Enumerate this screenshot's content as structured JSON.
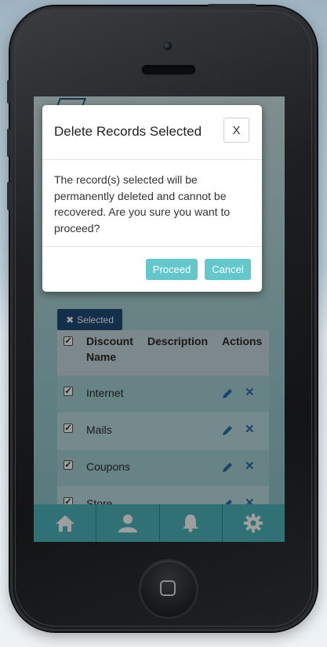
{
  "dialog": {
    "title": "Delete Records Selected",
    "close_label": "X",
    "message": "The record(s) selected will be permanently deleted and cannot be recovered. Are you sure you want to proceed?",
    "proceed_label": "Proceed",
    "cancel_label": "Cancel"
  },
  "toolbar": {
    "selected_label": "Selected",
    "selected_icon": "times-icon"
  },
  "table": {
    "headers": {
      "name": "Discount Name",
      "description": "Description",
      "actions": "Actions"
    },
    "rows": [
      {
        "name": "Internet",
        "checked": true
      },
      {
        "name": "Mails",
        "checked": true
      },
      {
        "name": "Coupons",
        "checked": true
      },
      {
        "name": "Store",
        "checked": true
      }
    ]
  },
  "tabbar": {
    "items": [
      "home-icon",
      "user-icon",
      "bell-icon",
      "gear-icon"
    ]
  },
  "colors": {
    "tabbar": "#4cb7bd",
    "primary_button": "#62c8cc",
    "selected_button": "#1f4d78",
    "action_icon": "#2a6fb0"
  }
}
